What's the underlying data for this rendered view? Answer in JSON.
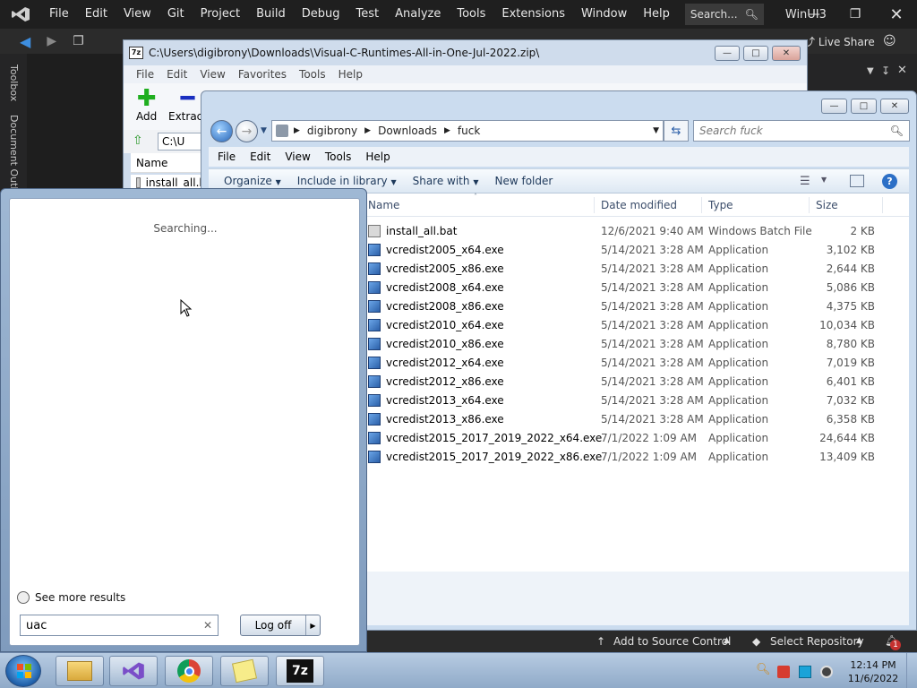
{
  "vs": {
    "menu": [
      "File",
      "Edit",
      "View",
      "Git",
      "Project",
      "Build",
      "Debug",
      "Test",
      "Analyze",
      "Tools",
      "Extensions",
      "Window",
      "Help"
    ],
    "search_label": "Search...",
    "title": "WinUI3",
    "live_share": "Live Share",
    "rail_labels": [
      "Toolbox",
      "Document Outl"
    ],
    "status": {
      "add_to_source_control": "Add to Source Control",
      "select_repository": "Select Repository",
      "notification_count": "1"
    }
  },
  "zip": {
    "title": "C:\\Users\\digibrony\\Downloads\\Visual-C-Runtimes-All-in-One-Jul-2022.zip\\",
    "logo": "7z",
    "menu": [
      "File",
      "Edit",
      "View",
      "Favorites",
      "Tools",
      "Help"
    ],
    "tools": [
      "Add",
      "Extract"
    ],
    "path_text": "C:\\U",
    "list_header": "Name",
    "first_file": "install_all.b"
  },
  "explorer": {
    "breadcrumb": [
      "digibrony",
      "Downloads",
      "fuck"
    ],
    "search_placeholder": "Search fuck",
    "menu": [
      "File",
      "Edit",
      "View",
      "Tools",
      "Help"
    ],
    "commands": [
      "Organize",
      "Include in library",
      "Share with",
      "New folder"
    ],
    "columns": [
      "Name",
      "Date modified",
      "Type",
      "Size"
    ],
    "files": [
      {
        "name": "install_all.bat",
        "date": "12/6/2021 9:40 AM",
        "type": "Windows Batch File",
        "size": "2 KB"
      },
      {
        "name": "vcredist2005_x64.exe",
        "date": "5/14/2021 3:28 AM",
        "type": "Application",
        "size": "3,102 KB"
      },
      {
        "name": "vcredist2005_x86.exe",
        "date": "5/14/2021 3:28 AM",
        "type": "Application",
        "size": "2,644 KB"
      },
      {
        "name": "vcredist2008_x64.exe",
        "date": "5/14/2021 3:28 AM",
        "type": "Application",
        "size": "5,086 KB"
      },
      {
        "name": "vcredist2008_x86.exe",
        "date": "5/14/2021 3:28 AM",
        "type": "Application",
        "size": "4,375 KB"
      },
      {
        "name": "vcredist2010_x64.exe",
        "date": "5/14/2021 3:28 AM",
        "type": "Application",
        "size": "10,034 KB"
      },
      {
        "name": "vcredist2010_x86.exe",
        "date": "5/14/2021 3:28 AM",
        "type": "Application",
        "size": "8,780 KB"
      },
      {
        "name": "vcredist2012_x64.exe",
        "date": "5/14/2021 3:28 AM",
        "type": "Application",
        "size": "7,019 KB"
      },
      {
        "name": "vcredist2012_x86.exe",
        "date": "5/14/2021 3:28 AM",
        "type": "Application",
        "size": "6,401 KB"
      },
      {
        "name": "vcredist2013_x64.exe",
        "date": "5/14/2021 3:28 AM",
        "type": "Application",
        "size": "7,032 KB"
      },
      {
        "name": "vcredist2013_x86.exe",
        "date": "5/14/2021 3:28 AM",
        "type": "Application",
        "size": "6,358 KB"
      },
      {
        "name": "vcredist2015_2017_2019_2022_x64.exe",
        "date": "7/1/2022 1:09 AM",
        "type": "Application",
        "size": "24,644 KB"
      },
      {
        "name": "vcredist2015_2017_2019_2022_x86.exe",
        "date": "7/1/2022 1:09 AM",
        "type": "Application",
        "size": "13,409 KB"
      }
    ]
  },
  "start_menu": {
    "searching": "Searching...",
    "see_more": "See more results",
    "search_value": "uac",
    "logoff": "Log off"
  },
  "taskbar": {
    "time": "12:14 PM",
    "date": "11/6/2022",
    "zip_label": "7z"
  },
  "colors": {
    "vs_dark": "#1f1f1f",
    "glass": "#cbdcef",
    "link_blue": "#1e395b"
  }
}
